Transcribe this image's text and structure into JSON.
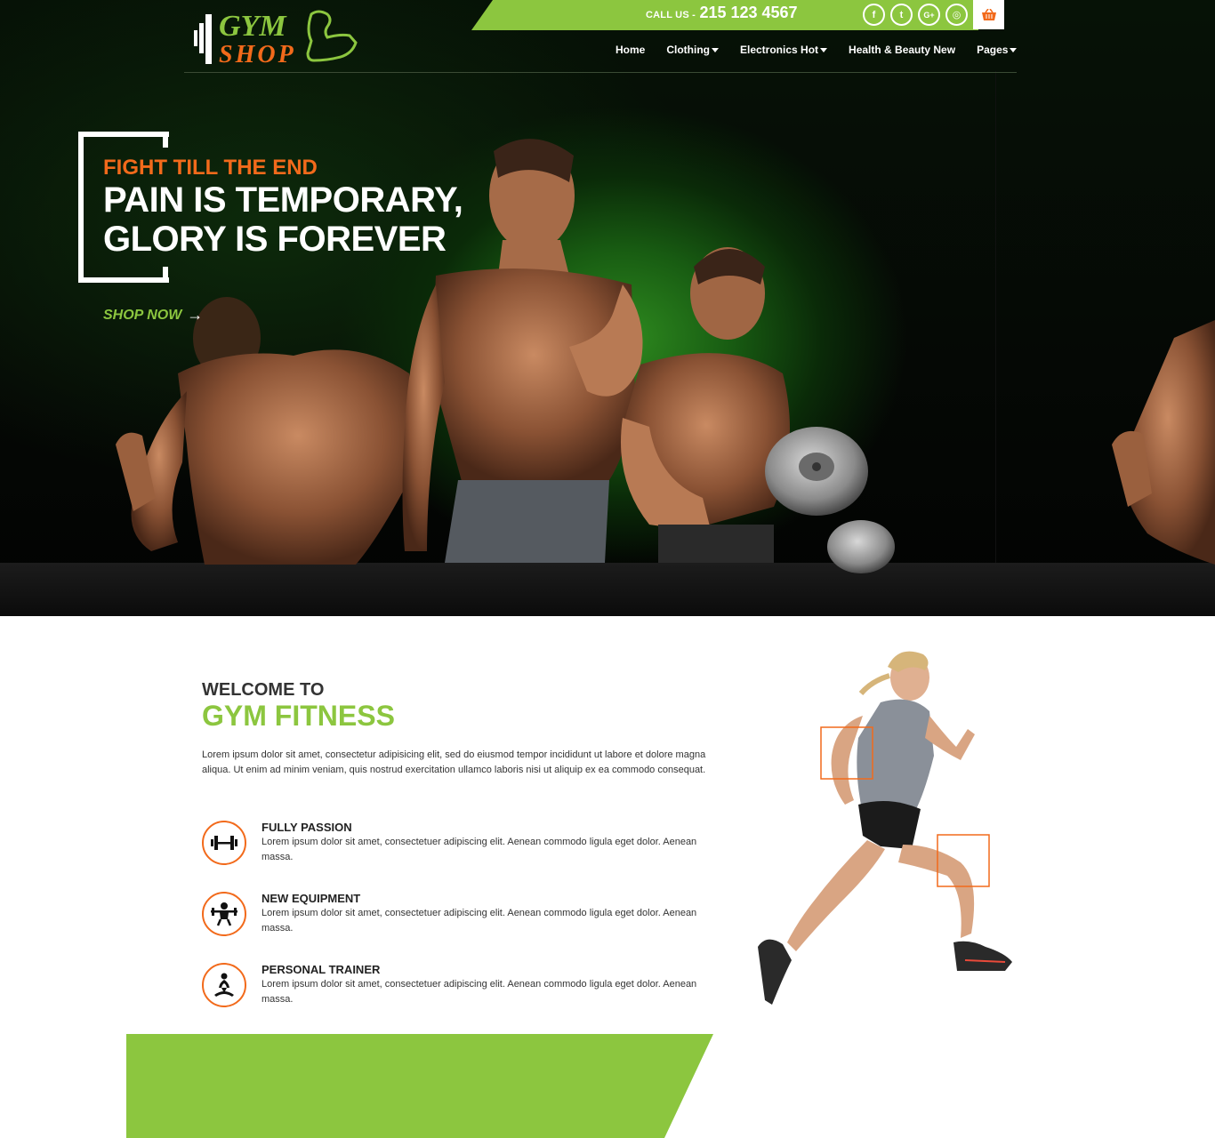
{
  "header": {
    "logo_text_top": "GYM",
    "logo_text_bottom": "SHOP",
    "call_label": "CALL US -",
    "call_number": "215 123 4567",
    "socials": [
      {
        "icon": "facebook-icon",
        "glyph": "f"
      },
      {
        "icon": "twitter-icon",
        "glyph": "t"
      },
      {
        "icon": "google-plus-icon",
        "glyph": "G+"
      },
      {
        "icon": "instagram-icon",
        "glyph": "◎"
      }
    ],
    "cart_icon": "basket-icon",
    "nav": [
      {
        "label": "Home",
        "dropdown": false
      },
      {
        "label": "Clothing",
        "dropdown": true
      },
      {
        "label": "Electronics Hot",
        "dropdown": true
      },
      {
        "label": "Health & Beauty New",
        "dropdown": false
      },
      {
        "label": "Pages",
        "dropdown": true
      }
    ]
  },
  "hero": {
    "tagline": "FIGHT TILL THE END",
    "headline_line1": "PAIN IS TEMPORARY,",
    "headline_line2": "GLORY IS FOREVER",
    "cta": "SHOP NOW",
    "cta_arrow": "→"
  },
  "welcome": {
    "small_title": "WELCOME TO",
    "big_title": "GYM FITNESS",
    "intro": "Lorem ipsum dolor sit amet, consectetur adipisicing elit, sed do eiusmod tempor incididunt ut labore et dolore magna aliqua. Ut enim ad minim veniam, quis nostrud exercitation ullamco laboris nisi ut aliquip ex ea commodo consequat.",
    "features": [
      {
        "title": "FULLY PASSION",
        "desc": "Lorem ipsum dolor sit amet, consectetuer adipiscing elit. Aenean commodo ligula eget dolor. Aenean massa.",
        "icon": "dumbbell-icon"
      },
      {
        "title": "NEW EQUIPMENT",
        "desc": "Lorem ipsum dolor sit amet, consectetuer adipiscing elit. Aenean commodo ligula eget dolor. Aenean massa.",
        "icon": "weightlifter-icon"
      },
      {
        "title": "PERSONAL TRAINER",
        "desc": "Lorem ipsum dolor sit amet, consectetuer adipiscing elit. Aenean commodo ligula eget dolor. Aenean massa.",
        "icon": "yoga-icon"
      }
    ]
  },
  "colors": {
    "accent_green": "#8cc63f",
    "accent_orange": "#f26a1b",
    "hero_dark": "#050805"
  }
}
